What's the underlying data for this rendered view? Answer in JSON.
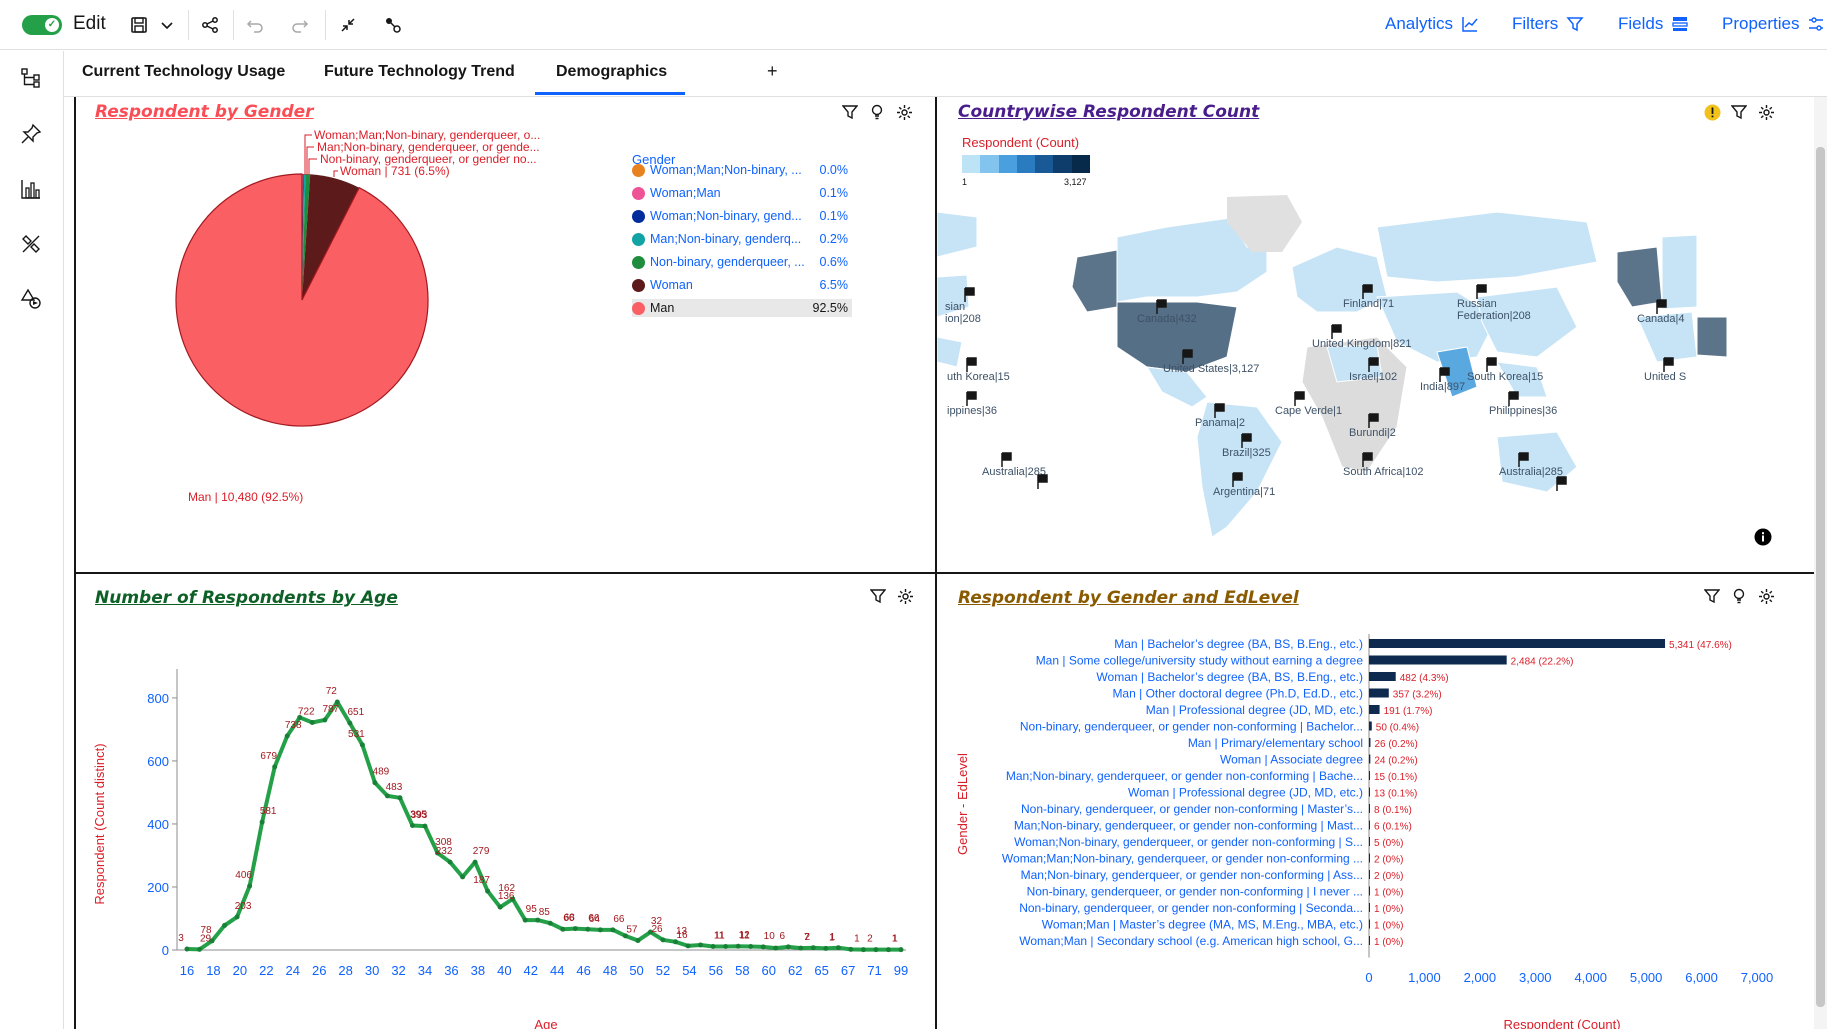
{
  "toolbar": {
    "edit_label": "Edit",
    "analytics": "Analytics",
    "filters": "Filters",
    "fields": "Fields",
    "properties": "Properties"
  },
  "tabs": [
    {
      "label": "Current Technology Usage"
    },
    {
      "label": "Future Technology Trend"
    },
    {
      "label": "Demographics"
    }
  ],
  "tab_add": "+",
  "panels": {
    "gender": {
      "title": "Respondent by Gender",
      "legend_title": "Gender",
      "legend": [
        {
          "label": "Woman;Man;Non-binary, ...",
          "value": "0.0%",
          "color": "#e8821e"
        },
        {
          "label": "Woman;Man",
          "value": "0.1%",
          "color": "#ee5396"
        },
        {
          "label": "Woman;Non-binary, gend...",
          "value": "0.1%",
          "color": "#002d9c"
        },
        {
          "label": "Man;Non-binary, genderq...",
          "value": "0.2%",
          "color": "#12a4a4"
        },
        {
          "label": "Non-binary, genderqueer, ...",
          "value": "0.6%",
          "color": "#1e8e3e"
        },
        {
          "label": "Woman",
          "value": "6.5%",
          "color": "#5c1a1a"
        },
        {
          "label": "Man",
          "value": "92.5%",
          "color": "#fa5f64"
        }
      ],
      "callouts": [
        "Woman;Man;Non-binary, genderqueer, o...",
        "Man;Non-binary, genderqueer, or gende...",
        "Non-binary, genderqueer, or gender no...",
        "Woman | 731 (6.5%)"
      ],
      "man_label": "Man | 10,480 (92.5%)"
    },
    "country": {
      "title": "Countrywise Respondent Count",
      "legend_title": "Respondent (Count)",
      "legend_min": "1",
      "legend_max": "3,127",
      "scale_colors": [
        "#bde3f7",
        "#82c4ee",
        "#4a9fde",
        "#2a7bc0",
        "#195a96",
        "#0e3d6b",
        "#082a4a"
      ],
      "labels": [
        {
          "text": "sian\nion|208"
        },
        {
          "text": "Canada|432"
        },
        {
          "text": "Finland|71"
        },
        {
          "text": "Russian\nFederation|208"
        },
        {
          "text": "Canada|4"
        },
        {
          "text": "United Kingdom|821"
        },
        {
          "text": "United States|3,127"
        },
        {
          "text": "Israel|102"
        },
        {
          "text": "South Korea|15"
        },
        {
          "text": "uth Korea|15"
        },
        {
          "text": "India|897"
        },
        {
          "text": "United S"
        },
        {
          "text": "ippines|36"
        },
        {
          "text": "Cape Verde|1"
        },
        {
          "text": "Philippines|36"
        },
        {
          "text": "Panama|2"
        },
        {
          "text": "Burundi|2"
        },
        {
          "text": "Brazil|325"
        },
        {
          "text": "Australia|285"
        },
        {
          "text": "South Africa|102"
        },
        {
          "text": "Australia|285"
        },
        {
          "text": "Argentina|71"
        }
      ]
    },
    "age": {
      "title": "Number of Respondents by Age",
      "ylabel": "Respondent (Count distinct)",
      "xlabel": "Age"
    },
    "edlevel": {
      "title": "Respondent by Gender and EdLevel",
      "ylabel": "Gender - EdLevel",
      "xlabel": "Respondent (Count)"
    }
  },
  "chart_data": [
    {
      "type": "pie",
      "title": "Respondent by Gender",
      "categories": [
        "Man",
        "Woman",
        "Non-binary, genderqueer, or gender non-conforming",
        "Man;Non-binary, genderqueer, or gender non-conforming",
        "Woman;Non-binary, genderqueer, or gender non-conforming",
        "Woman;Man",
        "Woman;Man;Non-binary, genderqueer, or gender non-conforming"
      ],
      "values": [
        10480,
        731,
        68,
        26,
        11,
        10,
        3
      ],
      "percent": [
        92.5,
        6.5,
        0.6,
        0.2,
        0.1,
        0.1,
        0.0
      ]
    },
    {
      "type": "line",
      "title": "Number of Respondents by Age",
      "xlabel": "Age",
      "ylabel": "Respondent (Count distinct)",
      "ylim": [
        0,
        860
      ],
      "x": [
        16,
        17,
        18,
        19,
        20,
        21,
        22,
        23,
        24,
        25,
        26,
        27,
        28,
        29,
        30,
        31,
        32,
        33,
        34,
        35,
        36,
        37,
        38,
        39,
        40,
        41,
        42,
        43,
        44,
        45,
        46,
        47,
        48,
        49,
        50,
        51,
        52,
        53,
        54,
        55,
        56,
        57,
        58,
        59,
        60,
        61,
        62,
        63,
        64,
        65,
        66,
        67,
        68,
        69,
        70,
        71,
        72,
        99
      ],
      "values": [
        3,
        2,
        29,
        78,
        105,
        203,
        406,
        581,
        679,
        738,
        722,
        730,
        787,
        720,
        651,
        531,
        489,
        483,
        395,
        393,
        308,
        279,
        232,
        279,
        187,
        136,
        162,
        95,
        95,
        85,
        66,
        68,
        66,
        64,
        64,
        45,
        30,
        57,
        32,
        26,
        13,
        16,
        11,
        11,
        12,
        11,
        10,
        6,
        10,
        6,
        7,
        5,
        7,
        2,
        1,
        1,
        1,
        1
      ],
      "x_ticks": [
        "16",
        "18",
        "20",
        "22",
        "24",
        "26",
        "28",
        "30",
        "32",
        "34",
        "36",
        "38",
        "40",
        "42",
        "44",
        "46",
        "48",
        "50",
        "52",
        "54",
        "56",
        "58",
        "60",
        "62",
        "65",
        "67",
        "71",
        "99"
      ],
      "point_labels": [
        "3",
        "29",
        "78",
        "203",
        "406",
        "581",
        "679",
        "738",
        "722",
        "787",
        "72",
        "651",
        "531",
        "489",
        "483",
        "395",
        "393",
        "308",
        "232",
        "279",
        "187",
        "136",
        "162",
        "95",
        "85",
        "66",
        "68",
        "66",
        "64",
        "66",
        "57",
        "32",
        "26",
        "13",
        "16",
        "11",
        "11",
        "12",
        "11",
        "10",
        "6",
        "7",
        "2",
        "1",
        "1",
        "1",
        "2",
        "1",
        "1"
      ],
      "y_ticks": [
        "0",
        "200",
        "400",
        "600",
        "800"
      ]
    },
    {
      "type": "bar",
      "title": "Respondent by Gender and EdLevel",
      "xlabel": "Respondent (Count)",
      "ylabel": "Gender - EdLevel",
      "xlim": [
        0,
        7000
      ],
      "x_ticks": [
        "0",
        "1,000",
        "2,000",
        "3,000",
        "4,000",
        "5,000",
        "6,000",
        "7,000"
      ],
      "categories": [
        "Man | Bachelor’s degree (BA, BS, B.Eng., etc.)",
        "Man | Some college/university study without earning a degree",
        "Woman | Bachelor’s degree (BA, BS, B.Eng., etc.)",
        "Man | Other doctoral degree (Ph.D, Ed.D., etc.)",
        "Man | Professional degree (JD, MD, etc.)",
        "Non-binary, genderqueer, or gender non-conforming | Bachelor...",
        "Man | Primary/elementary school",
        "Woman | Associate degree",
        "Man;Non-binary, genderqueer, or gender non-conforming | Bache...",
        "Woman | Professional degree (JD, MD, etc.)",
        "Non-binary, genderqueer, or gender non-conforming | Master’s...",
        "Man;Non-binary, genderqueer, or gender non-conforming | Mast...",
        "Woman;Non-binary, genderqueer, or gender non-conforming | S...",
        "Woman;Man;Non-binary, genderqueer, or gender non-conforming ...",
        "Man;Non-binary, genderqueer, or gender non-conforming | Ass...",
        "Non-binary, genderqueer, or gender non-conforming | I never ...",
        "Non-binary, genderqueer, or gender non-conforming | Seconda...",
        "Woman;Man | Master’s degree (MA, MS, M.Eng., MBA, etc.)",
        "Woman;Man | Secondary school (e.g. American high school, G..."
      ],
      "values": [
        5341,
        2484,
        482,
        357,
        191,
        50,
        26,
        24,
        15,
        13,
        8,
        6,
        5,
        2,
        2,
        1,
        1,
        1,
        1
      ],
      "labels": [
        "5,341 (47.6%)",
        "2,484 (22.2%)",
        "482 (4.3%)",
        "357 (3.2%)",
        "191 (1.7%)",
        "50 (0.4%)",
        "26 (0.2%)",
        "24 (0.2%)",
        "15 (0.1%)",
        "13 (0.1%)",
        "8 (0.1%)",
        "6 (0.1%)",
        "5 (0%)",
        "2 (0%)",
        "2 (0%)",
        "1 (0%)",
        "1 (0%)",
        "1 (0%)",
        "1 (0%)"
      ]
    }
  ]
}
